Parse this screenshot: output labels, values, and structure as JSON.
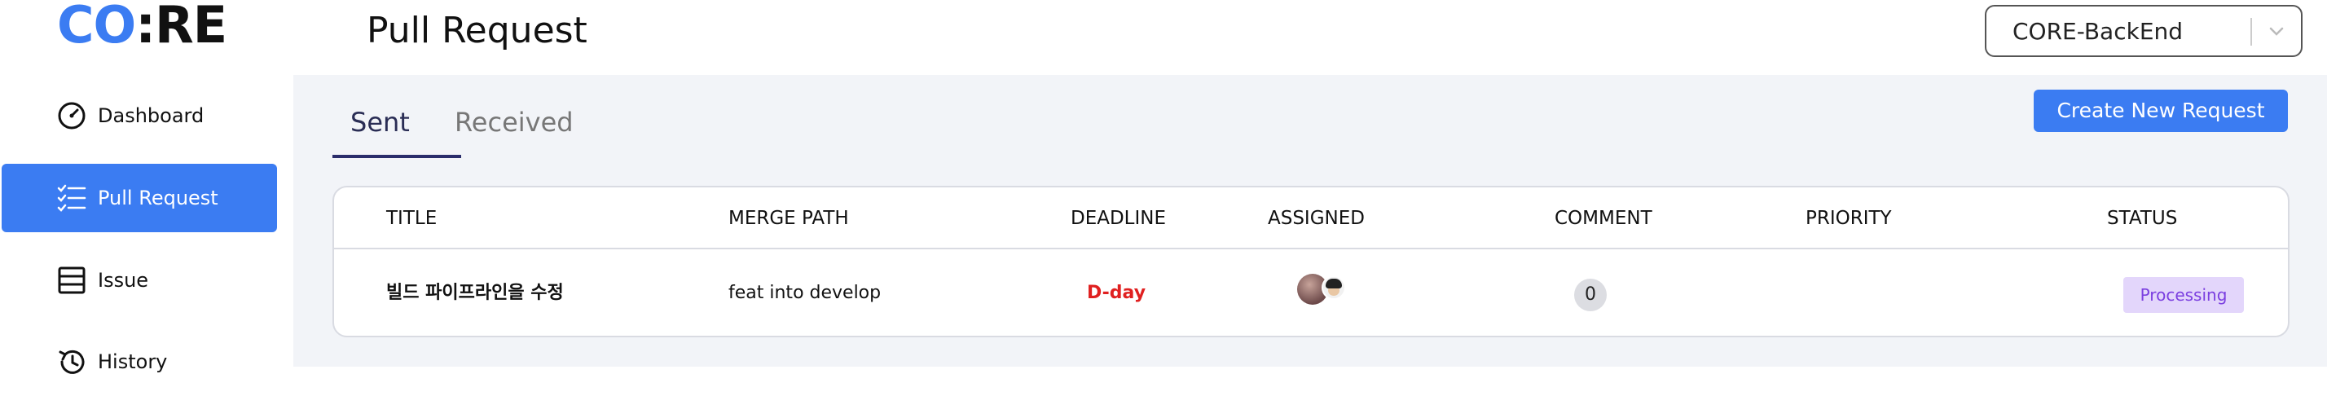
{
  "header": {
    "logo_part1": "CO",
    "logo_part2": ":",
    "logo_part3": "RE",
    "page_title": "Pull Request",
    "project_selected": "CORE-BackEnd"
  },
  "sidebar": {
    "items": [
      {
        "label": "Dashboard",
        "icon": "dashboard-icon",
        "active": false
      },
      {
        "label": "Pull Request",
        "icon": "checklist-icon",
        "active": true
      },
      {
        "label": "Issue",
        "icon": "list-icon",
        "active": false
      },
      {
        "label": "History",
        "icon": "history-icon",
        "active": false
      }
    ]
  },
  "main": {
    "tabs": [
      {
        "label": "Sent",
        "active": true
      },
      {
        "label": "Received",
        "active": false
      }
    ],
    "create_button": "Create New Request",
    "table": {
      "columns": [
        "TITLE",
        "MERGE PATH",
        "DEADLINE",
        "ASSIGNED",
        "COMMENT",
        "PRIORITY",
        "STATUS"
      ],
      "rows": [
        {
          "title": "빌드 파이프라인을 수정",
          "merge_path": "feat into develop",
          "deadline": "D-day",
          "comment_count": "0",
          "priority": "",
          "status": "Processing"
        }
      ]
    }
  },
  "colors": {
    "accent": "#3b7cf2",
    "deadline": "#e02020",
    "status_bg": "#e3d6fb",
    "status_text": "#7b3fe0"
  }
}
